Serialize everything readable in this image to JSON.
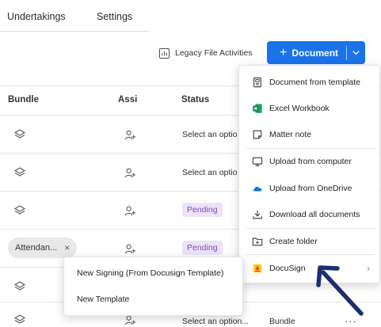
{
  "tabs": [
    {
      "label": "Undertakings"
    },
    {
      "label": "Settings"
    }
  ],
  "toolbar": {
    "legacy_label": "Legacy File Activities",
    "document_button_label": "Document",
    "document_button_plus": "+",
    "accent_color": "#1a73e8"
  },
  "table": {
    "headers": {
      "bundle": "Bundle",
      "assignee": "Assi",
      "status": "Status"
    },
    "rows": [
      {
        "bundle_icon": "layers-icon",
        "assignee_icon": "add-person-icon",
        "status_text": "Select an optio"
      },
      {
        "bundle_icon": "layers-icon",
        "assignee_icon": "add-person-icon",
        "status_text": "Select an optio"
      },
      {
        "bundle_icon": "layers-icon",
        "assignee_icon": "add-person-icon",
        "status_pill": "Pending"
      },
      {
        "bundle_chip": "Attendan...",
        "chip_close": "×",
        "assignee_icon": "add-person-icon",
        "status_pill": "Pending"
      },
      {
        "bundle_icon": "layers-icon",
        "assignee_icon": "add-person-icon"
      },
      {
        "bundle_icon": "layers-icon",
        "assignee_icon": "add-person-icon",
        "status_text": "Select an option...",
        "bundle_text": "Bundle",
        "more": "···"
      }
    ],
    "pending_color": "#7b4ab6"
  },
  "dropdown": {
    "items": [
      {
        "label": "Document from template",
        "icon": "document-template-icon"
      },
      {
        "label": "Excel Workbook",
        "icon": "excel-icon"
      },
      {
        "label": "Matter note",
        "icon": "note-icon"
      },
      {
        "label": "Upload from computer",
        "icon": "monitor-icon"
      },
      {
        "label": "Upload from OneDrive",
        "icon": "onedrive-icon"
      },
      {
        "label": "Download all documents",
        "icon": "download-icon"
      },
      {
        "label": "Create folder",
        "icon": "folder-plus-icon"
      },
      {
        "label": "DocuSign",
        "icon": "docusign-icon",
        "chevron": "›"
      }
    ]
  },
  "submenu": {
    "items": [
      {
        "label": "New Signing (From Docusign Template)"
      },
      {
        "label": "New Template"
      }
    ]
  }
}
